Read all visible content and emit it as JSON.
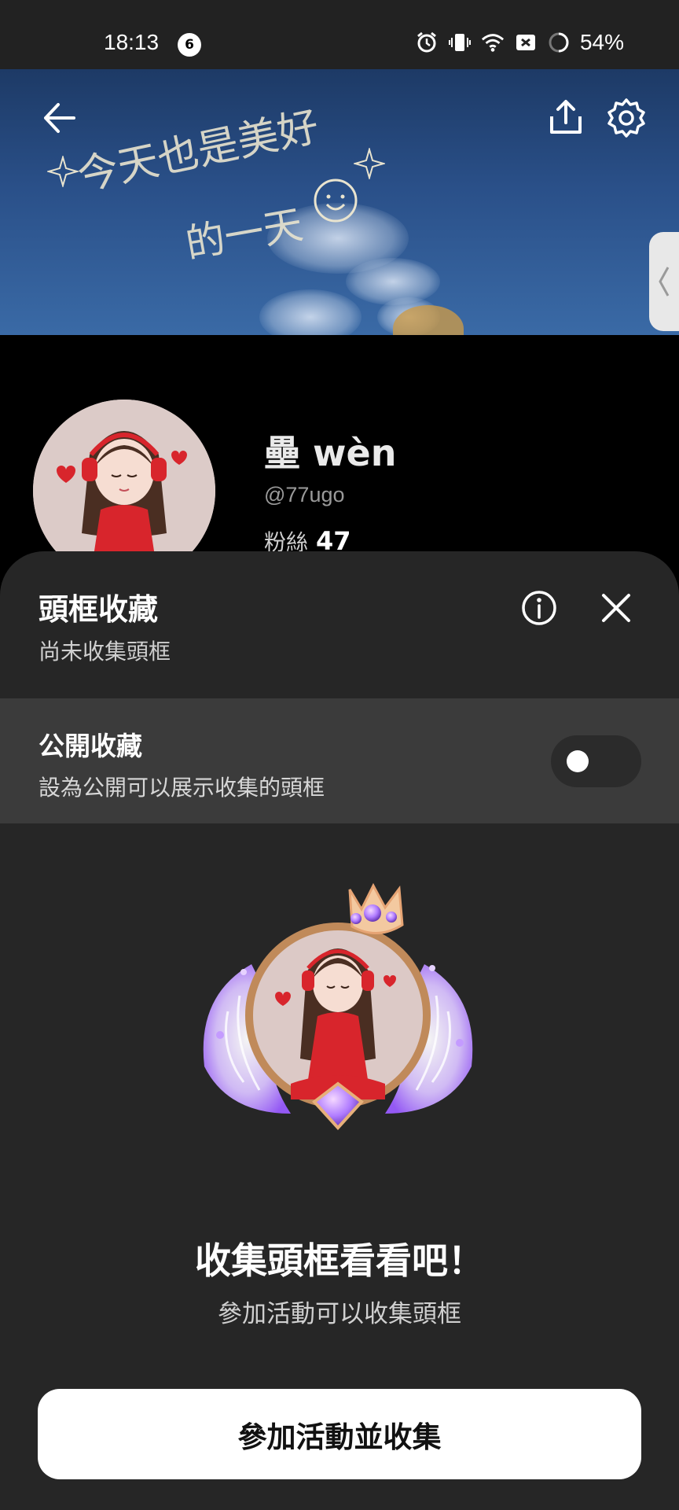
{
  "status_bar": {
    "time": "18:13",
    "notification_count": "6",
    "battery": "54%",
    "icons": [
      "alarm-icon",
      "vibrate-icon",
      "wifi-icon",
      "no-signal-icon",
      "battery-saver-icon"
    ]
  },
  "cover": {
    "handwriting_line1": "今天也是美好",
    "handwriting_line2": "的一天"
  },
  "profile": {
    "name": "壘 wèn",
    "handle": "@77ugo",
    "fans_label": "粉絲",
    "fans_count": "47"
  },
  "sheet": {
    "title": "頭框收藏",
    "subtitle": "尚未收集頭框",
    "public_row": {
      "title": "公開收藏",
      "subtitle": "設為公開可以展示收集的頭框",
      "toggle_on": false
    },
    "empty_title": "收集頭框看看吧！",
    "empty_subtitle": "參加活動可以收集頭框",
    "button_label": "參加活動並收集"
  },
  "colors": {
    "sheet_bg": "#262626",
    "row_bg": "#3b3b3b",
    "accent_red": "#d8252c",
    "frame_purple": "#b07cff"
  }
}
